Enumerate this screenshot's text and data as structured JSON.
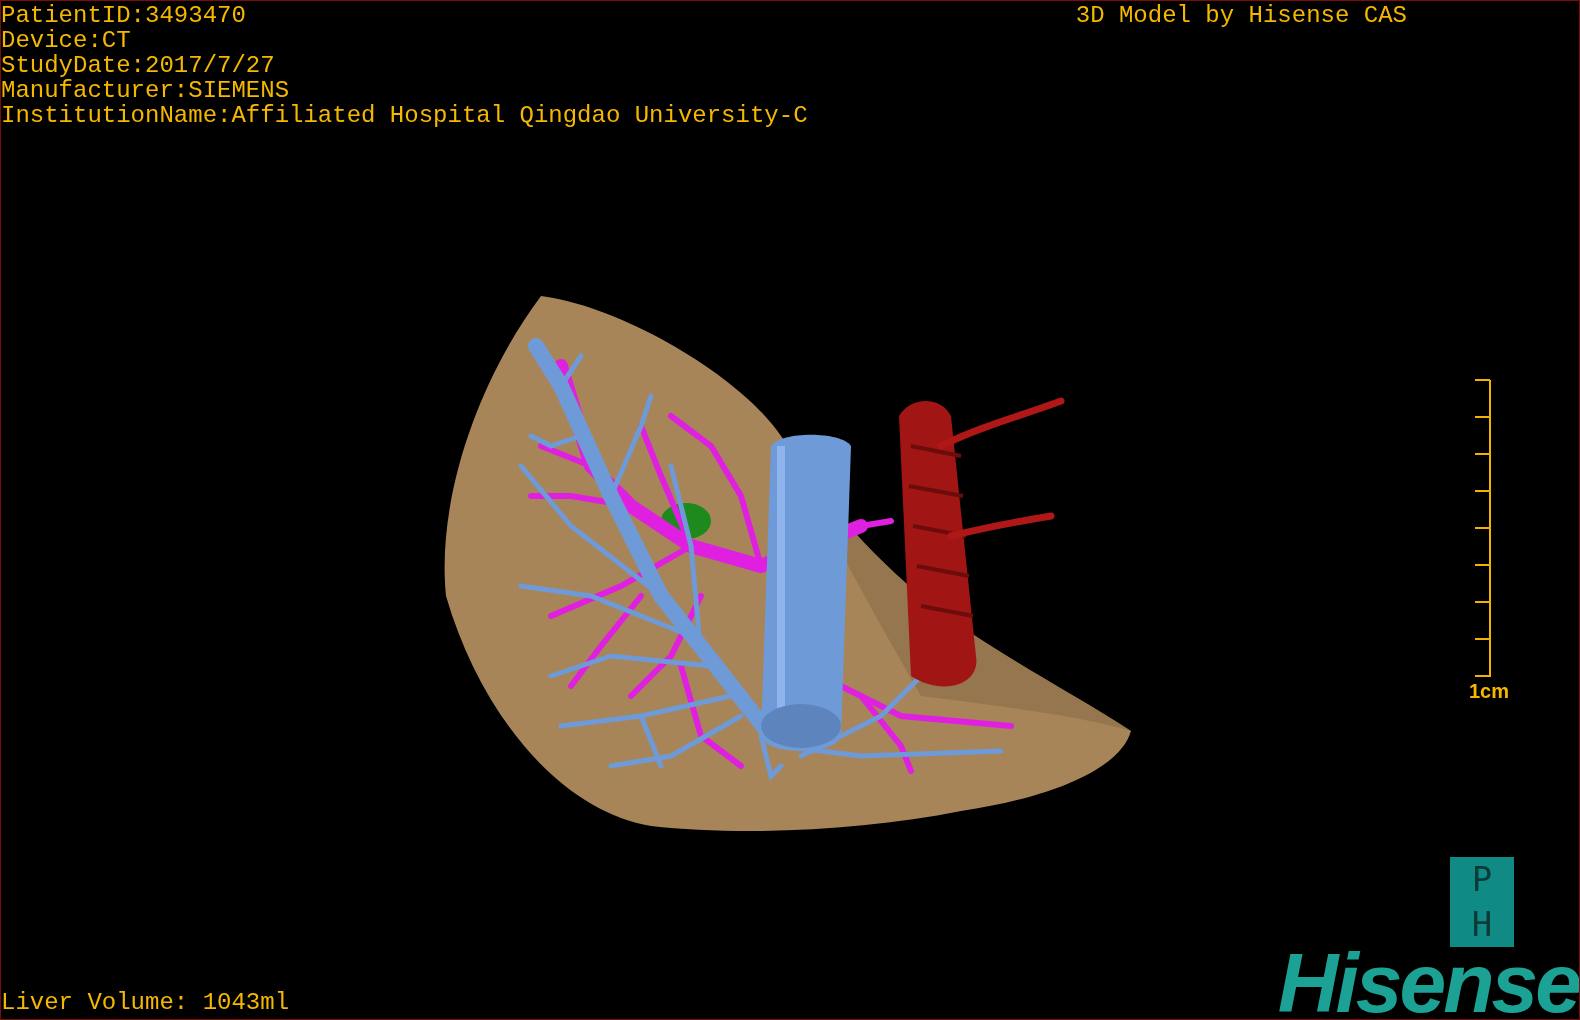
{
  "overlay": {
    "info_lines": [
      "PatientID:3493470",
      "Device:CT",
      "StudyDate:2017/7/27",
      "Manufacturer:SIEMENS",
      "InstitutionName:Affiliated Hospital Qingdao University-C"
    ],
    "title": "3D Model by Hisense CAS",
    "scale_label": "1cm",
    "volume": "Liver Volume: 1043ml"
  },
  "logo": {
    "letters": [
      "P",
      "H"
    ],
    "wordmark": "Hisense"
  }
}
